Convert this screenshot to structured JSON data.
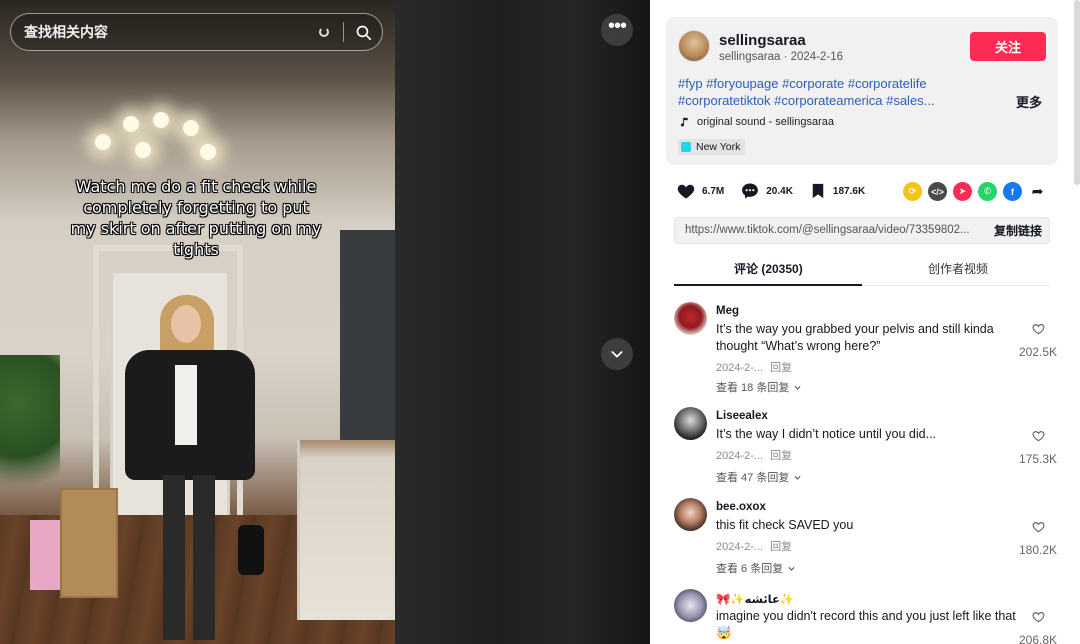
{
  "search": {
    "placeholder": "查找相关内容"
  },
  "video": {
    "caption": "Watch me do a fit check while completely forgetting to put my skirt on after putting on my tights"
  },
  "author": {
    "name": "sellingsaraa",
    "handle": "sellingsaraa",
    "date": "2024-2-16",
    "follow_label": "关注"
  },
  "description": {
    "tags_line1": "#fyp #foryoupage #corporate #corporatelife",
    "tags_line2": "#corporatetiktok #corporateamerica #sales...",
    "more_label": "更多"
  },
  "music": {
    "label": "original sound - sellingsaraa"
  },
  "location": {
    "label": "New York"
  },
  "stats": {
    "likes": "6.7M",
    "comments": "20.4K",
    "saves": "187.6K"
  },
  "share_icons": [
    "repost-icon",
    "embed-icon",
    "send-icon",
    "whatsapp-icon",
    "facebook-icon",
    "share-arrow-icon"
  ],
  "link": {
    "url": "https://www.tiktok.com/@sellingsaraa/video/73359802...",
    "copy_label": "复制链接"
  },
  "tabs": {
    "comments": "评论 (20350)",
    "creator_videos": "创作者视频"
  },
  "comments": [
    {
      "user": "Meg",
      "text": "It’s the way you grabbed your pelvis and still kinda thought “What’s wrong here?”",
      "date": "2024-2-...",
      "reply_label": "回复",
      "view_replies": "查看 18 条回复",
      "likes": "202.5K"
    },
    {
      "user": "Liseealex",
      "text": "It’s the way I didn’t notice until you did...",
      "date": "2024-2-...",
      "reply_label": "回复",
      "view_replies": "查看 47 条回复",
      "likes": "175.3K"
    },
    {
      "user": "bee.oxox",
      "text": "this fit check SAVED you",
      "date": "2024-2-...",
      "reply_label": "回复",
      "view_replies": "查看 6 条回复",
      "likes": "180.2K"
    },
    {
      "user": "🎀✨عائشه✨",
      "text": "imagine you didn't record this and you just left like that🤯",
      "likes": "206.8K"
    }
  ],
  "colors": {
    "accent": "#fe2c55",
    "hashtag": "#2b5db9",
    "text": "#161823"
  }
}
